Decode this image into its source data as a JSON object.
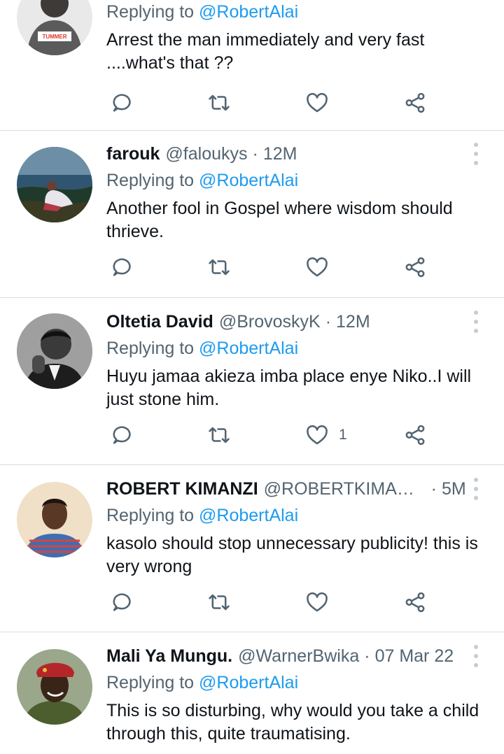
{
  "icons": {
    "reply": "reply-icon",
    "retweet": "retweet-icon",
    "like": "heart-icon",
    "share": "share-icon",
    "more": "more-vertical-icon"
  },
  "colors": {
    "link": "#1d9bf0",
    "secondary_text": "#536471",
    "primary_text": "#0f1419",
    "divider": "#d6dbe0"
  },
  "tweets": [
    {
      "replying_prefix": "Replying to",
      "replying_mention": "@RobertAlai",
      "text": "Arrest the man immediately and very fast ....what's that ??",
      "avatar_text": "TUMMER"
    },
    {
      "name": "farouk",
      "handle": "@faloukys",
      "separator": "·",
      "time": "12M",
      "replying_prefix": "Replying to",
      "replying_mention": "@RobertAlai",
      "text": "Another fool in Gospel where wisdom should thrieve."
    },
    {
      "name": "Oltetia David",
      "handle": "@BrovoskyK",
      "separator": "·",
      "time": "12M",
      "replying_prefix": "Replying to",
      "replying_mention": "@RobertAlai",
      "text": "Huyu jamaa akieza imba place enye Niko..I will just stone him.",
      "like_count": "1"
    },
    {
      "name": "ROBERT KIMANZI",
      "handle": "@ROBERTKIMANZI...",
      "separator": "·",
      "time": "5M",
      "replying_prefix": "Replying to",
      "replying_mention": "@RobertAlai",
      "text": "kasolo should stop unnecessary publicity! this is very wrong"
    },
    {
      "name": "Mali Ya Mungu.",
      "handle": "@WarnerBwika",
      "separator": "·",
      "time": "07 Mar 22",
      "replying_prefix": "Replying to",
      "replying_mention": "@RobertAlai",
      "text": "This is so disturbing, why would you take a child through this, quite traumatising."
    }
  ]
}
